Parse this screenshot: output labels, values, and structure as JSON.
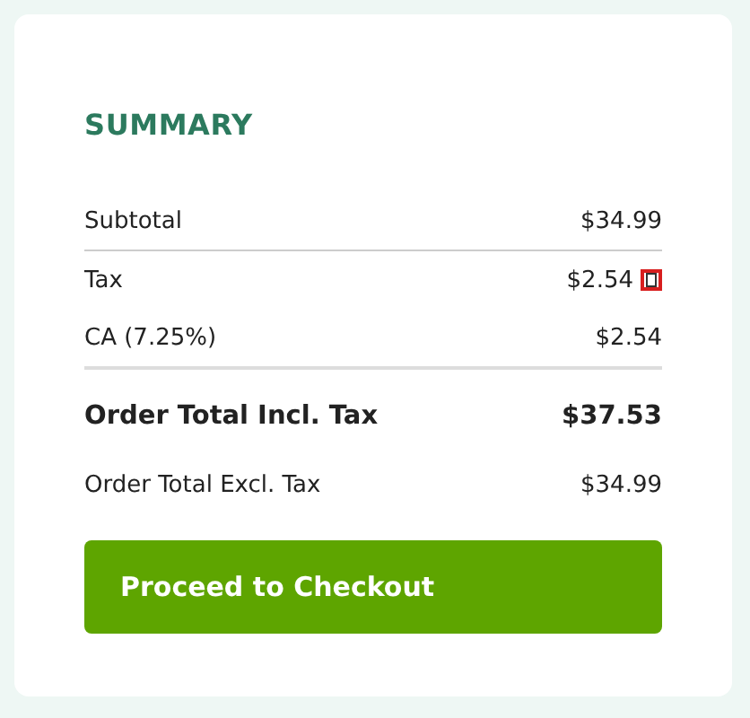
{
  "summary": {
    "title": "SUMMARY",
    "rows": [
      {
        "kind": "subtotal",
        "label": "Subtotal",
        "value": "$34.99",
        "marker": false
      },
      {
        "kind": "tax",
        "label": "Tax",
        "value": "$2.54",
        "marker": true
      },
      {
        "kind": "rate",
        "label": "CA (7.25%)",
        "value": "$2.54",
        "marker": false
      },
      {
        "kind": "grand",
        "label": "Order Total Incl. Tax",
        "value": "$37.53",
        "marker": false
      },
      {
        "kind": "net",
        "label": "Order Total Excl. Tax",
        "value": "$34.99",
        "marker": false
      }
    ],
    "button": "Proceed to Checkout"
  }
}
